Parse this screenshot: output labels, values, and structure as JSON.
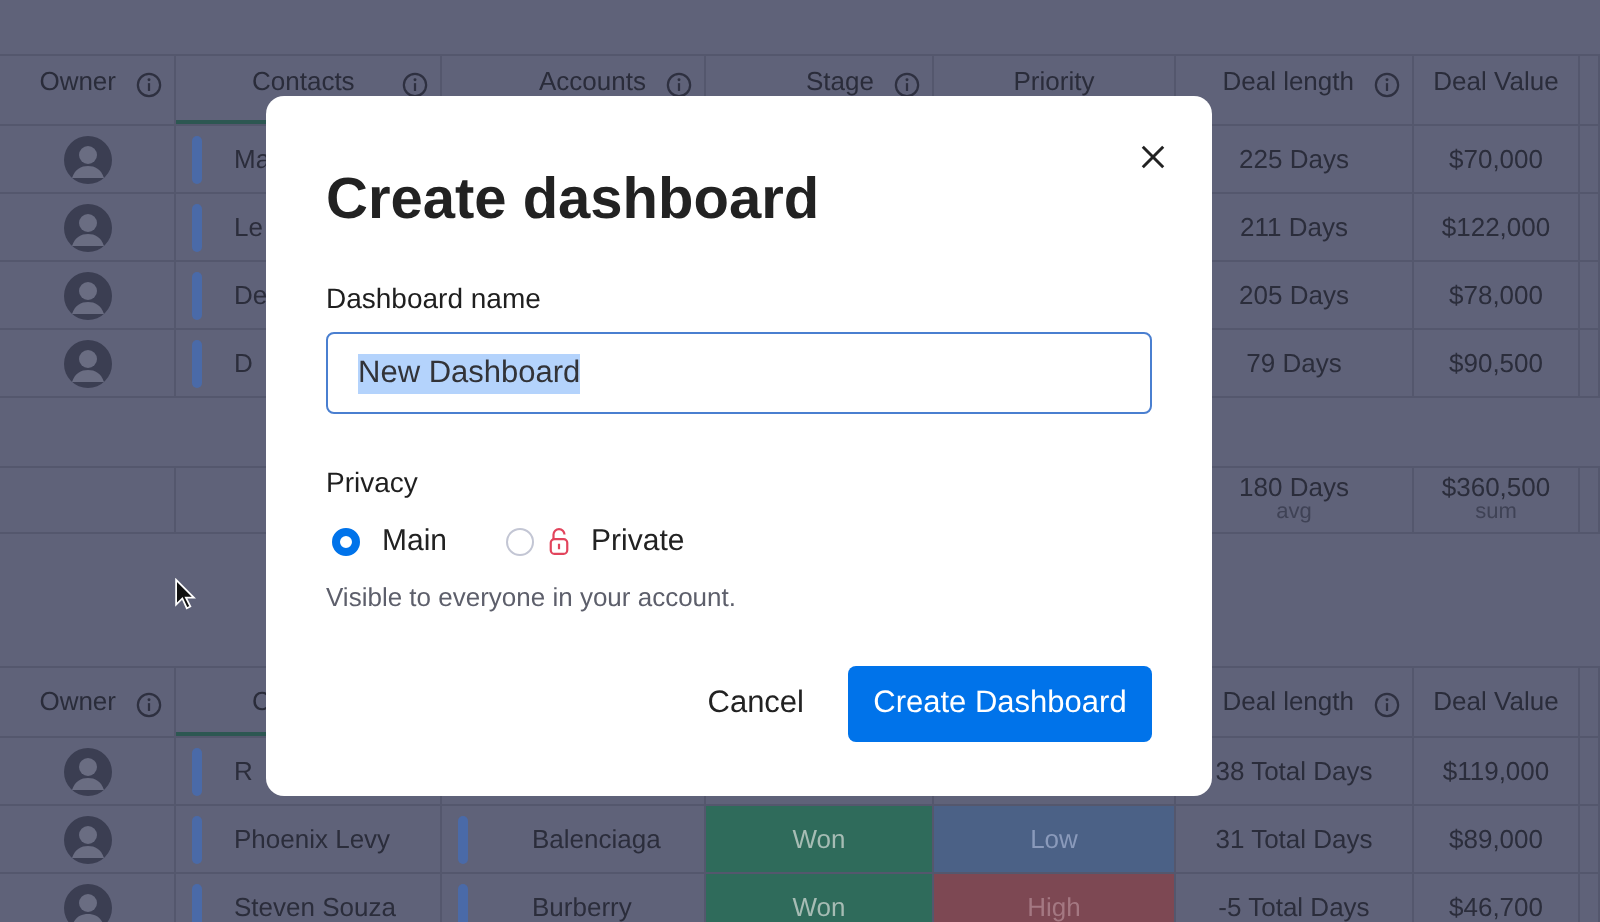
{
  "board": {
    "groups": [
      {
        "columns": [
          {
            "label": "Owner",
            "kind": "info"
          },
          {
            "label": "Contacts",
            "kind": "info"
          },
          {
            "label": "Accounts",
            "kind": "info"
          },
          {
            "label": "Stage",
            "kind": "info"
          },
          {
            "label": "Priority",
            "kind": "plain"
          },
          {
            "label": "Deal length",
            "kind": "info"
          },
          {
            "label": "Deal Value",
            "kind": "plain"
          }
        ],
        "rows": [
          {
            "contact": "Ma",
            "deal_length": "225 Days",
            "deal_value": "$70,000"
          },
          {
            "contact": "Le",
            "deal_length": "211 Days",
            "deal_value": "$122,000"
          },
          {
            "contact": "De",
            "deal_length": "205 Days",
            "deal_value": "$78,000"
          },
          {
            "contact": "D",
            "deal_length": "79 Days",
            "deal_value": "$90,500"
          }
        ],
        "summary": {
          "deal_length": {
            "value": "180 Days",
            "label": "avg"
          },
          "deal_value": {
            "value": "$360,500",
            "label": "sum"
          }
        }
      },
      {
        "columns": [
          {
            "label": "Owner",
            "kind": "info"
          },
          {
            "label": "C",
            "kind": "plain"
          },
          {
            "kind": "plain"
          },
          {
            "kind": "plain"
          },
          {
            "kind": "plain"
          },
          {
            "label": "Deal length",
            "kind": "info"
          },
          {
            "label": "Deal Value",
            "kind": "plain"
          }
        ],
        "rows": [
          {
            "contact": "R",
            "deal_length": "38 Total Days",
            "deal_value": "$119,000"
          },
          {
            "contact": "Phoenix Levy",
            "account": "Balenciaga",
            "stage": {
              "label": "Won",
              "color": "#2f6b5b"
            },
            "priority": {
              "label": "Low",
              "color": "#4b6186"
            },
            "deal_length": "31 Total Days",
            "deal_value": "$89,000"
          },
          {
            "contact": "Steven Souza",
            "account": "Burberry",
            "stage": {
              "label": "Won",
              "color": "#2f6b5b"
            },
            "priority": {
              "label": "High",
              "color": "#7d4853"
            },
            "deal_length": "-5 Total Days",
            "deal_value": "$46,700"
          }
        ]
      }
    ]
  },
  "dialog": {
    "title": "Create dashboard",
    "name_label": "Dashboard name",
    "name_value": "New Dashboard",
    "text_selected": true,
    "privacy_label": "Privacy",
    "options": [
      {
        "label": "Main",
        "selected": true,
        "kind": "plain"
      },
      {
        "label": "Private",
        "selected": false,
        "kind": "locked"
      }
    ],
    "hint": "Visible to everyone in your account.",
    "buttons": [
      {
        "label": "Cancel",
        "kind": "text"
      },
      {
        "label": "Create Dashboard",
        "kind": "primary"
      }
    ]
  }
}
